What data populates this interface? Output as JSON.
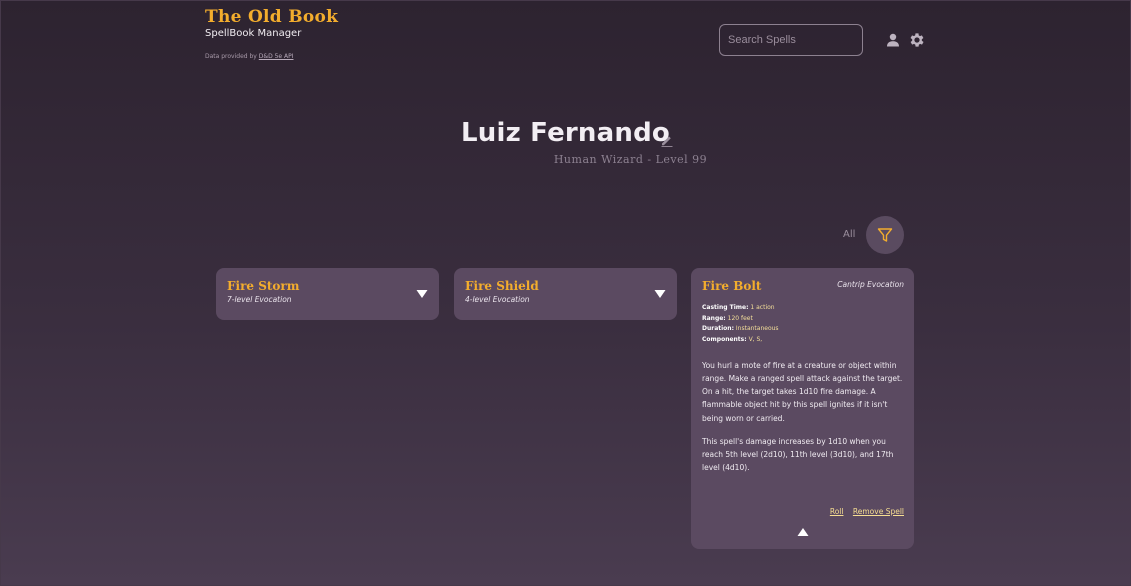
{
  "brand": {
    "title": "The Old Book",
    "subtitle": "SpellBook Manager",
    "credit_prefix": "Data provided by",
    "credit_link": "D&D 5e API"
  },
  "header": {
    "search_placeholder": "Search Spells",
    "user_icon": "user-icon",
    "settings_icon": "gear-icon"
  },
  "character": {
    "name": "Luiz Fernando",
    "subtitle": "Human Wizard - Level 99"
  },
  "filter": {
    "label": "All",
    "icon": "funnel-icon",
    "accent": "#f3ad2d"
  },
  "cards": [
    {
      "title": "Fire Storm",
      "subtitle": "7-level Evocation"
    },
    {
      "title": "Fire Shield",
      "subtitle": "4-level Evocation"
    }
  ],
  "expanded_card": {
    "title": "Fire Bolt",
    "type": "Cantrip Evocation",
    "props": [
      {
        "label": "Casting Time:",
        "value": "1 action"
      },
      {
        "label": "Range:",
        "value": "120 feet"
      },
      {
        "label": "Duration:",
        "value": "Instantaneous"
      },
      {
        "label": "Components:",
        "value": "V, S,"
      }
    ],
    "description": [
      "You hurl a mote of fire at a creature or object within range. Make a ranged spell attack against the target. On a hit, the target takes 1d10 fire damage. A flammable object hit by this spell ignites if it isn't being worn or carried.",
      "This spell's damage increases by 1d10 when you reach 5th level (2d10), 11th level (3d10), and 17th level (4d10)."
    ],
    "roll_label": "Roll",
    "remove_label": "Remove Spell"
  },
  "colors": {
    "accent": "#f3ad2d",
    "card_bg": "#5b4a61",
    "link": "#f6de92"
  }
}
